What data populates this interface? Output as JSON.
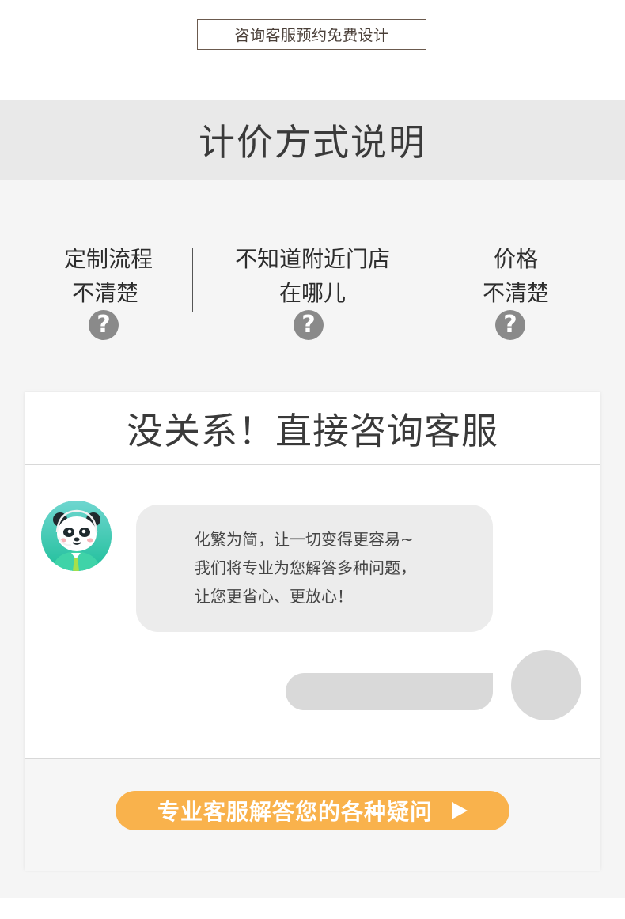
{
  "top_button": {
    "label": "咨询客服预约免费设计"
  },
  "section_heading": "计价方式说明",
  "questions": [
    {
      "line1": "定制流程",
      "line2": "不清楚",
      "mark": "?"
    },
    {
      "line1": "不知道附近门店",
      "line2": "在哪儿",
      "mark": "?"
    },
    {
      "line1": "价格",
      "line2": "不清楚",
      "mark": "?"
    }
  ],
  "card": {
    "title": "没关系！直接咨询客服",
    "agent_message": [
      "化繁为简，让一切变得更容易~",
      "我们将专业为您解答多种问题，",
      "让您更省心、更放心！"
    ],
    "cta_label": "专业客服解答您的各种疑问"
  },
  "colors": {
    "accent_orange": "#f9b24c",
    "heading_band": "#e9e9e9",
    "question_mark": "#8a8a8a",
    "avatar_bg": "#2ec8b0"
  },
  "icons": {
    "agent_avatar": "panda-agent-avatar",
    "user_avatar": "user-avatar-placeholder",
    "cta_arrow": "play-arrow-icon",
    "question": "question-mark-icon"
  }
}
